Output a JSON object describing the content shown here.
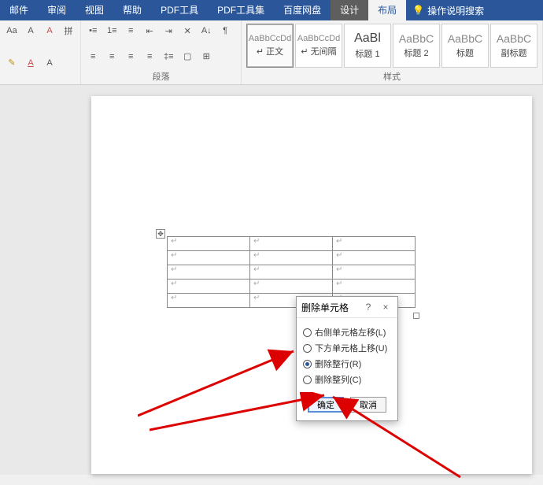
{
  "tabs": {
    "mail": "邮件",
    "review": "审阅",
    "view": "视图",
    "help": "帮助",
    "pdf_tools": "PDF工具",
    "pdf_toolset": "PDF工具集",
    "baidu_netdisk": "百度网盘",
    "design": "设计",
    "layout": "布局",
    "tell_me": "操作说明搜索"
  },
  "ribbon": {
    "group_paragraph": "段落",
    "group_styles": "样式"
  },
  "styles": {
    "preview_generic": "AaBbCcDd",
    "preview_heading": "AaBl",
    "preview_sub": "AaBbC",
    "normal": "↵ 正文",
    "no_spacing": "↵ 无间隔",
    "heading1": "标题 1",
    "heading2": "标题 2",
    "title": "标题",
    "subtitle": "副标题"
  },
  "table": {
    "cell_marker": "↵"
  },
  "dialog": {
    "title": "删除单元格",
    "help": "?",
    "close": "×",
    "opt_shift_left": "右侧单元格左移(L)",
    "opt_shift_up": "下方单元格上移(U)",
    "opt_delete_row": "删除整行(R)",
    "opt_delete_col": "删除整列(C)",
    "ok": "确定",
    "cancel": "取消"
  }
}
